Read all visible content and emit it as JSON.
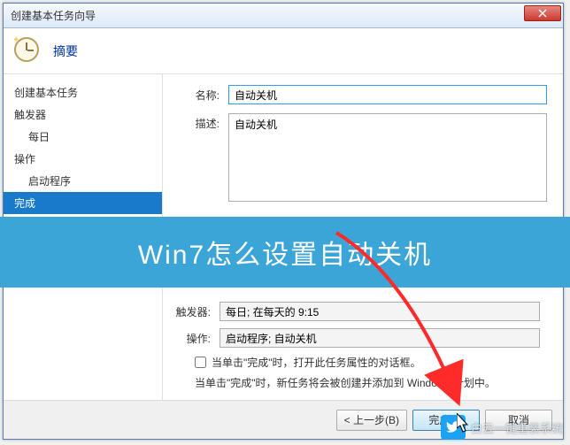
{
  "window": {
    "title": "创建基本任务向导"
  },
  "header": {
    "title": "摘要"
  },
  "sidebar": {
    "items": [
      {
        "label": "创建基本任务",
        "sub": false
      },
      {
        "label": "触发器",
        "sub": false
      },
      {
        "label": "每日",
        "sub": true
      },
      {
        "label": "操作",
        "sub": false
      },
      {
        "label": "启动程序",
        "sub": true
      },
      {
        "label": "完成",
        "sub": false,
        "selected": true
      }
    ]
  },
  "form": {
    "name_label": "名称:",
    "name_value": "自动关机",
    "desc_label": "描述:",
    "desc_value": "自动关机",
    "trigger_label": "触发器:",
    "trigger_value": "每日; 在每天的 9:15",
    "action_label": "操作:",
    "action_value": "启动程序; 自动关机",
    "checkbox_label": "当单击\"完成\"时，打开此任务属性的对话框。",
    "hint": "当单击\"完成\"时，新任务将会被创建并添加到 Windows 计划中。"
  },
  "buttons": {
    "back": "< 上一步(B)",
    "finish": "完成(F)",
    "cancel": "取消"
  },
  "banner": {
    "text": "Win7怎么设置自动关机"
  },
  "watermark": {
    "text": "白云一键重装系统"
  }
}
